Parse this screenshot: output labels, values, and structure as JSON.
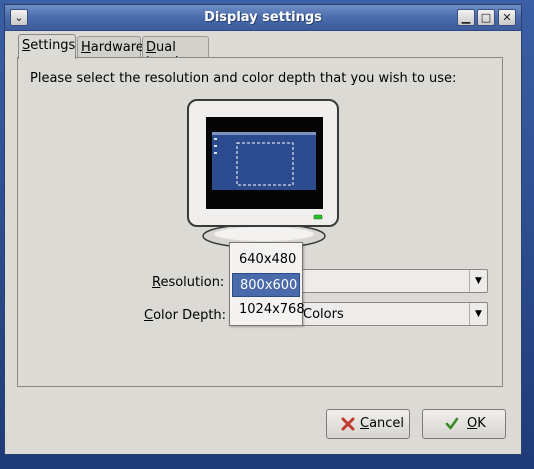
{
  "window": {
    "title": "Display settings",
    "menu_glyph": "⌄",
    "minimize_glyph": "▁",
    "maximize_glyph": "□",
    "close_glyph": "✕"
  },
  "tabs": [
    {
      "label": "Settings",
      "mnemonic": "S",
      "rest": "ettings",
      "active": true
    },
    {
      "label": "Hardware",
      "mnemonic": "H",
      "rest": "ardware",
      "active": false
    },
    {
      "label": "Dual head",
      "mnemonic": "D",
      "rest": "ual head",
      "active": false
    }
  ],
  "settings": {
    "prompt": "Please select the resolution and color depth that you wish to use:",
    "resolution": {
      "label_mnemonic": "R",
      "label_rest": "esolution:",
      "options": [
        "640x480",
        "800x600",
        "1024x768"
      ],
      "selected": "800x600"
    },
    "color_depth": {
      "label_mnemonic": "C",
      "label_rest": "olor Depth:",
      "value_visible": "Colors"
    }
  },
  "buttons": {
    "cancel": {
      "mnemonic": "C",
      "rest": "ancel",
      "icon": "cancel-icon",
      "icon_color": "#c0392b"
    },
    "ok": {
      "mnemonic": "O",
      "rest": "K",
      "icon": "checkmark-icon",
      "icon_color": "#3a8a2a"
    }
  },
  "colors": {
    "titlebar": "#4a6bab",
    "selection": "#4a6bab",
    "window_bg": "#dcdad5",
    "screen_bg": "#2c4b8f",
    "power_led": "#29c229"
  }
}
